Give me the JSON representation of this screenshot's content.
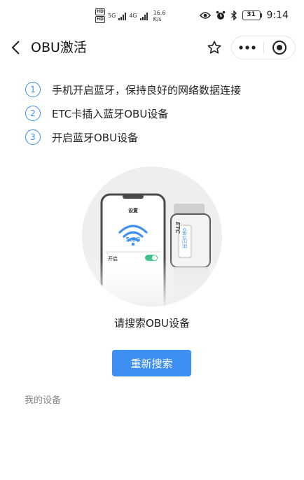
{
  "status_bar": {
    "hd_tags": [
      "HD",
      "HD"
    ],
    "network_type": "4G",
    "network_type_2": "5G",
    "speed_value": "16.6",
    "speed_unit": "K/s",
    "battery": "31",
    "time": "9:14"
  },
  "nav": {
    "title": "OBU激活"
  },
  "steps": [
    {
      "num": "1",
      "text": "手机开启蓝牙，保持良好的网络数据连接"
    },
    {
      "num": "2",
      "text": "ETC卡插入蓝牙OBU设备"
    },
    {
      "num": "3",
      "text": "开启蓝牙OBU设备"
    }
  ],
  "illustration": {
    "phone_header": "设置",
    "wifi_band": "5.8G",
    "toggle_label": "开启",
    "device_brand": "ETC",
    "device_label": "OBU已开"
  },
  "search_status": "请搜索OBU设备",
  "research_button": "重新搜索",
  "my_devices_label": "我的设备",
  "colors": {
    "accent": "#3d90f2",
    "toggle": "#3ec38c"
  }
}
